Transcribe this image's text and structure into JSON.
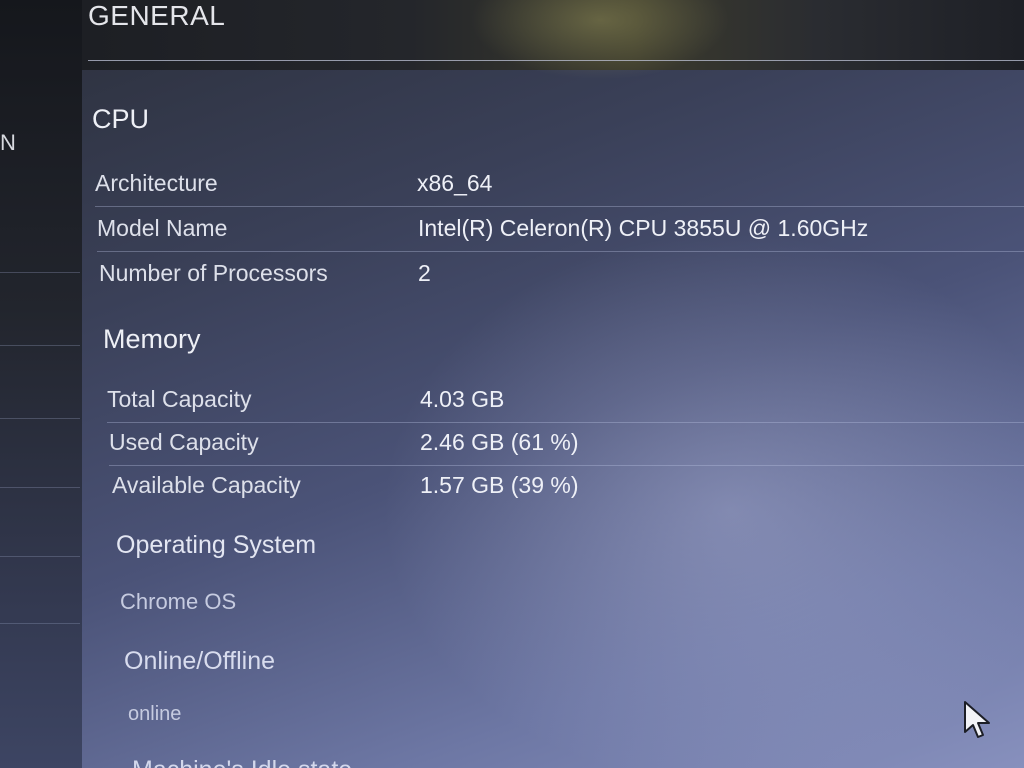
{
  "sidebar": {
    "partial_label": "N"
  },
  "header": {
    "title": "GENERAL"
  },
  "cpu": {
    "title": "CPU",
    "rows": [
      {
        "label": "Architecture",
        "value": "x86_64"
      },
      {
        "label": "Model Name",
        "value": "Intel(R) Celeron(R) CPU 3855U @ 1.60GHz"
      },
      {
        "label": "Number of Processors",
        "value": "2"
      }
    ]
  },
  "memory": {
    "title": "Memory",
    "rows": [
      {
        "label": "Total Capacity",
        "value": "4.03 GB"
      },
      {
        "label": "Used Capacity",
        "value": "2.46 GB (61 %)"
      },
      {
        "label": "Available Capacity",
        "value": "1.57 GB (39 %)"
      }
    ]
  },
  "os": {
    "title": "Operating System",
    "value": "Chrome OS"
  },
  "online": {
    "title": "Online/Offline",
    "value": "online"
  },
  "idle": {
    "title": "Machine's Idle state"
  },
  "icons": {
    "cursor": "mouse-pointer-icon"
  }
}
